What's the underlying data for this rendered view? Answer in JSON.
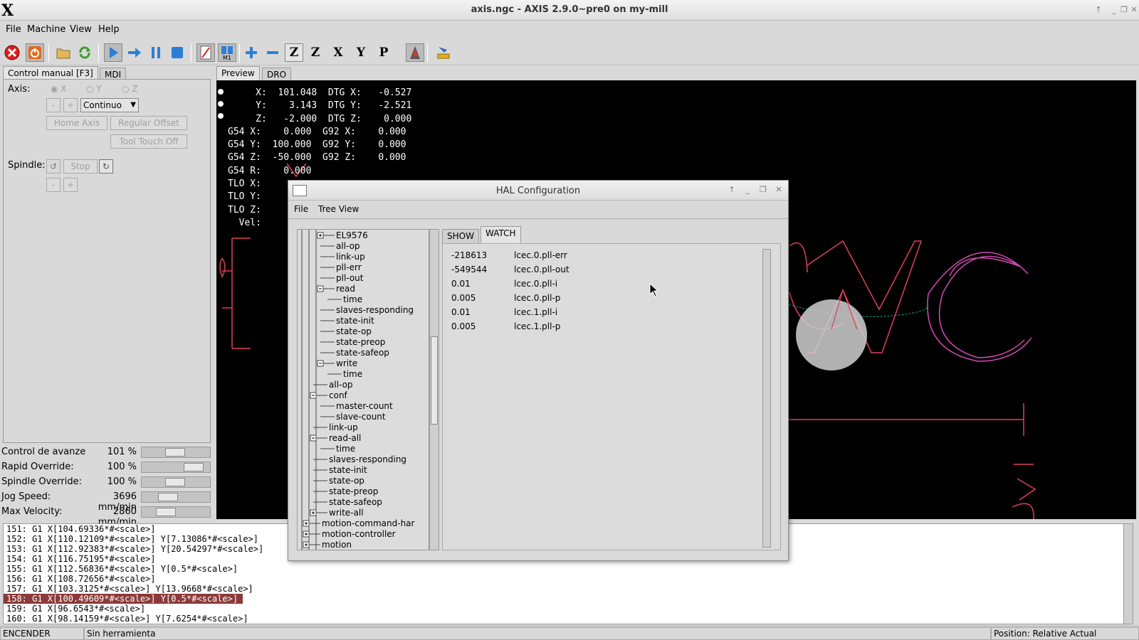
{
  "window": {
    "title": "axis.ngc - AXIS 2.9.0~pre0 on my-mill",
    "x_logo": "X",
    "buttons": [
      "↑",
      "_",
      "❐",
      "✕"
    ]
  },
  "menubar": [
    "File",
    "Machine",
    "View",
    "Help"
  ],
  "toolbar": {
    "icons": [
      "estop-icon",
      "power-icon",
      "open-file-icon",
      "reload-icon",
      "run-icon",
      "step-icon",
      "pause-icon",
      "stop-icon",
      "block-delete-icon",
      "optional-stop-icon",
      "zoom-in-icon",
      "zoom-out-icon",
      "view-z-icon",
      "view-z2-icon",
      "view-x-icon",
      "view-y-icon",
      "view-p-icon",
      "rotate-icon",
      "clear-plot-icon"
    ],
    "axis_views": [
      "Z",
      "Z",
      "X",
      "Y",
      "P"
    ]
  },
  "left_tabs": [
    "Control manual [F3]",
    "MDI"
  ],
  "manual": {
    "axis_label": "Axis:",
    "axes": [
      "X",
      "Y",
      "Z"
    ],
    "minus": "-",
    "plus": "+",
    "jog_mode": "Continuo",
    "home_axis": "Home Axis",
    "regular_offset": "Regular Offset",
    "tool_touch_off": "Tool Touch Off",
    "spindle_label": "Spindle:",
    "stop": "Stop"
  },
  "overrides": [
    {
      "label": "Control de avanze",
      "value": "101 %",
      "level": 0.5
    },
    {
      "label": "Rapid Override:",
      "value": "100 %",
      "level": 0.9
    },
    {
      "label": "Spindle Override:",
      "value": "100 %",
      "level": 0.5
    },
    {
      "label": "Jog Speed:",
      "value": "3696 mm/min",
      "level": 0.35
    },
    {
      "label": "Max Velocity:",
      "value": "2860 mm/min",
      "level": 0.3
    }
  ],
  "preview_tabs": [
    "Preview",
    "DRO"
  ],
  "dro_lines": [
    "     X:  101.048  DTG X:   -0.527",
    "     Y:    3.143  DTG Y:   -2.521",
    "     Z:   -2.000  DTG Z:    0.000",
    "G54 X:    0.000  G92 X:    0.000",
    "G54 Y:  100.000  G92 Y:    0.000",
    "G54 Z:  -50.000  G92 Z:    0.000",
    "G54 R:    0.000",
    "TLO X:",
    "TLO Y:",
    "TLO Z:",
    "  Vel:"
  ],
  "code_lines": [
    {
      "text": "151: G1 X[104.69336*#<scale>]",
      "selected": false
    },
    {
      "text": "152: G1 X[110.12109*#<scale>] Y[7.13086*#<scale>]",
      "selected": false
    },
    {
      "text": "153: G1 X[112.92383*#<scale>] Y[20.54297*#<scale>]",
      "selected": false
    },
    {
      "text": "154: G1 X[116.75195*#<scale>]",
      "selected": false
    },
    {
      "text": "155: G1 X[112.56836*#<scale>] Y[0.5*#<scale>]",
      "selected": false
    },
    {
      "text": "156: G1 X[108.72656*#<scale>]",
      "selected": false
    },
    {
      "text": "157: G1 X[103.3125*#<scale>] Y[13.9668*#<scale>]",
      "selected": false
    },
    {
      "text": "158: G1 X[100.49609*#<scale>] Y[0.5*#<scale>]",
      "selected": true
    },
    {
      "text": "159: G1 X[96.6543*#<scale>]",
      "selected": false
    },
    {
      "text": "160: G1 X[98.14159*#<scale>] Y[7.6254*#<scale>]",
      "selected": false
    }
  ],
  "status": {
    "state": "ENCENDER",
    "tool": "Sin herramienta",
    "position": "Position: Relative Actual"
  },
  "hal": {
    "title": "HAL Configuration",
    "menu": [
      "File",
      "Tree View"
    ],
    "tabs": [
      "SHOW",
      "WATCH"
    ],
    "tree": [
      {
        "label": "EL9576",
        "indent": 3,
        "expander": "+"
      },
      {
        "label": "all-op",
        "indent": 3,
        "expander": ""
      },
      {
        "label": "link-up",
        "indent": 3,
        "expander": ""
      },
      {
        "label": "pll-err",
        "indent": 3,
        "expander": ""
      },
      {
        "label": "pll-out",
        "indent": 3,
        "expander": ""
      },
      {
        "label": "read",
        "indent": 3,
        "expander": "-"
      },
      {
        "label": "time",
        "indent": 4,
        "expander": ""
      },
      {
        "label": "slaves-responding",
        "indent": 3,
        "expander": ""
      },
      {
        "label": "state-init",
        "indent": 3,
        "expander": ""
      },
      {
        "label": "state-op",
        "indent": 3,
        "expander": ""
      },
      {
        "label": "state-preop",
        "indent": 3,
        "expander": ""
      },
      {
        "label": "state-safeop",
        "indent": 3,
        "expander": ""
      },
      {
        "label": "write",
        "indent": 3,
        "expander": "-"
      },
      {
        "label": "time",
        "indent": 4,
        "expander": ""
      },
      {
        "label": "all-op",
        "indent": 2,
        "expander": ""
      },
      {
        "label": "conf",
        "indent": 2,
        "expander": "-"
      },
      {
        "label": "master-count",
        "indent": 3,
        "expander": ""
      },
      {
        "label": "slave-count",
        "indent": 3,
        "expander": ""
      },
      {
        "label": "link-up",
        "indent": 2,
        "expander": ""
      },
      {
        "label": "read-all",
        "indent": 2,
        "expander": "-"
      },
      {
        "label": "time",
        "indent": 3,
        "expander": ""
      },
      {
        "label": "slaves-responding",
        "indent": 2,
        "expander": ""
      },
      {
        "label": "state-init",
        "indent": 2,
        "expander": ""
      },
      {
        "label": "state-op",
        "indent": 2,
        "expander": ""
      },
      {
        "label": "state-preop",
        "indent": 2,
        "expander": ""
      },
      {
        "label": "state-safeop",
        "indent": 2,
        "expander": ""
      },
      {
        "label": "write-all",
        "indent": 2,
        "expander": "+"
      },
      {
        "label": "motion-command-har",
        "indent": 1,
        "expander": "+"
      },
      {
        "label": "motion-controller",
        "indent": 1,
        "expander": "+"
      },
      {
        "label": "motion",
        "indent": 1,
        "expander": "+"
      }
    ],
    "watch": [
      {
        "value": "-218613",
        "name": "lcec.0.pll-err"
      },
      {
        "value": "-549544",
        "name": "lcec.0.pll-out"
      },
      {
        "value": "0.01",
        "name": "lcec.0.pll-i"
      },
      {
        "value": "0.005",
        "name": "lcec.0.pll-p"
      },
      {
        "value": "0.01",
        "name": "lcec.1.pll-i"
      },
      {
        "value": "0.005",
        "name": "lcec.1.pll-p"
      }
    ]
  },
  "colors": {
    "toolpath": "#e0405a",
    "toolpath_magenta": "#d04ab0",
    "feed": "#1aa08c"
  }
}
